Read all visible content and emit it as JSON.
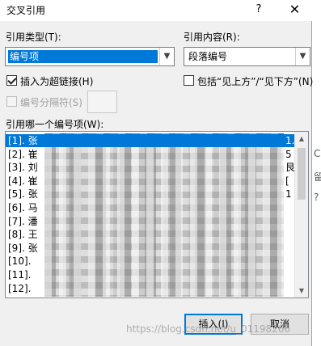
{
  "window": {
    "title": "交叉引用",
    "help_glyph": "?",
    "close_glyph": "✕"
  },
  "ref_type": {
    "label": "引用类型(T):",
    "value": "编号项"
  },
  "ref_content": {
    "label": "引用内容(R):",
    "value": "段落编号"
  },
  "insert_hyperlink": {
    "label": "插入为超链接(H)",
    "checked": true
  },
  "include_above_below": {
    "label": "包括“见上方”/“见下方”(N)",
    "checked": false
  },
  "separator": {
    "label": "编号分隔符(S)",
    "checked": false,
    "enabled": false
  },
  "list": {
    "label": "引用哪一个编号项(W):",
    "items": [
      {
        "num": "[1]. 张",
        "tail": "1.",
        "selected": true
      },
      {
        "num": "[2]. 崔",
        "tail": "5"
      },
      {
        "num": "[3]. 刘",
        "tail": "艮"
      },
      {
        "num": "[4]. 崔",
        "tail": "["
      },
      {
        "num": "[5]. 张",
        "tail": "1"
      },
      {
        "num": "[6]. 马",
        "tail": ""
      },
      {
        "num": "[7]. 潘",
        "tail": ""
      },
      {
        "num": "[8]. 王",
        "tail": ""
      },
      {
        "num": "[9]. 张",
        "tail": ""
      },
      {
        "num": "[10]. ",
        "tail": ""
      },
      {
        "num": "[11]. ",
        "tail": ""
      },
      {
        "num": "[12]. ",
        "tail": ""
      }
    ]
  },
  "buttons": {
    "insert": "插入(I)",
    "cancel": "取消"
  },
  "watermark": "https://blog.csdn.net/u_01198266",
  "side_chars": [
    "C",
    "留",
    "?"
  ],
  "colors": {
    "selection": "#0078d7",
    "dialog_bg": "#f0f0f0"
  },
  "icons": {
    "dropdown": "chevron-down-icon",
    "scroll_up": "chevron-up-icon",
    "scroll_down": "chevron-down-icon"
  }
}
